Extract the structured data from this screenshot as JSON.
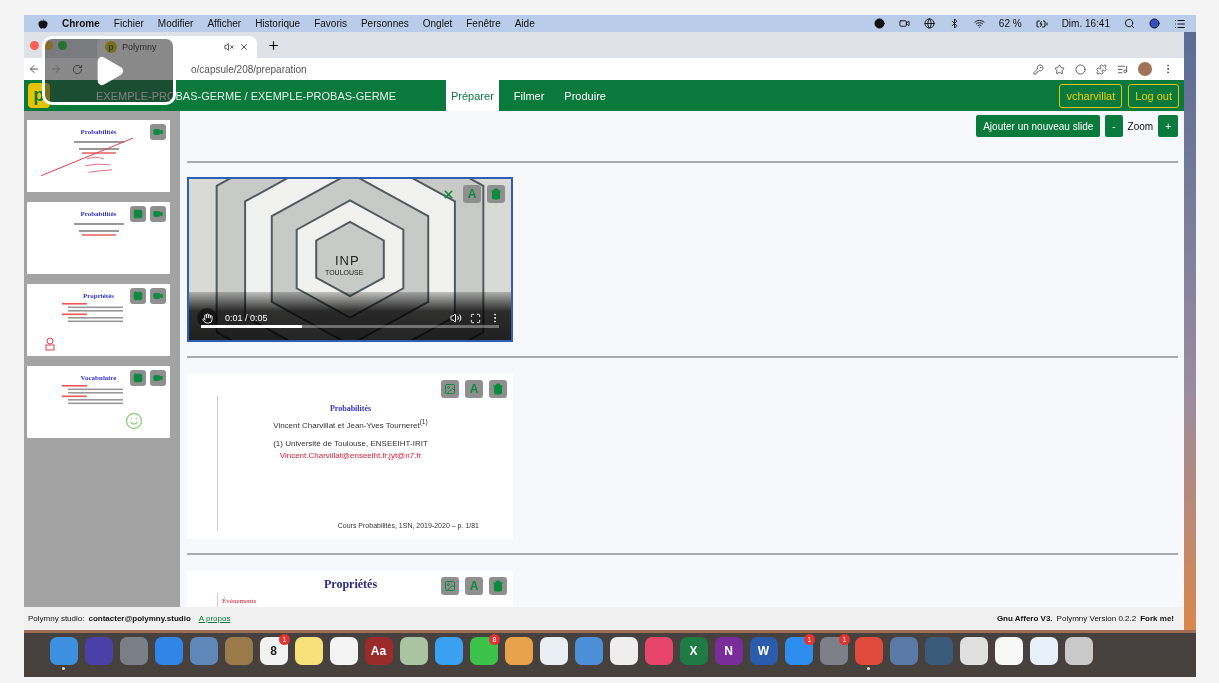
{
  "menu_bar": {
    "app": "Chrome",
    "items": [
      "Fichier",
      "Modifier",
      "Afficher",
      "Historique",
      "Favoris",
      "Personnes",
      "Onglet",
      "Fenêtre",
      "Aide"
    ],
    "battery": "62 %",
    "clock": "Dim. 16:41"
  },
  "browser": {
    "favicon": "p",
    "tab_title": "Polymny",
    "url": "o/capsule/208/preparation"
  },
  "video_overlay": {
    "playing": false
  },
  "app_header": {
    "logo": "p",
    "capsule_title": "EXEMPLE-PROBAS-GERME / EXEMPLE-PROBAS-GERME",
    "tabs": [
      {
        "label": "Préparer",
        "selected": true
      },
      {
        "label": "Filmer",
        "selected": false
      },
      {
        "label": "Produire",
        "selected": false
      }
    ],
    "user": "vcharvillat",
    "logout": "Log out"
  },
  "sidebar": {
    "slides": [
      {
        "title": "Probabilités",
        "kind": "title",
        "annotation": {
          "kind": "handwriting"
        },
        "actions": [
          {
            "kind": "video"
          }
        ]
      },
      {
        "title": "Probabilités",
        "kind": "title",
        "actions": [
          {
            "kind": "film"
          },
          {
            "kind": "video"
          }
        ]
      },
      {
        "title": "Propriétés",
        "kind": "list",
        "annotation": {
          "kind": "figure"
        },
        "actions": [
          {
            "kind": "film"
          },
          {
            "kind": "video"
          }
        ]
      },
      {
        "title": "Vocabulaire",
        "kind": "list",
        "annotation": {
          "kind": "smiley"
        },
        "actions": [
          {
            "kind": "film"
          },
          {
            "kind": "video"
          }
        ]
      }
    ]
  },
  "toolbar": {
    "add": "Ajouter un nouveau slide",
    "zoom_out": "-",
    "zoom_label": "Zoom",
    "zoom_in": "+"
  },
  "items": [
    {
      "kind": "video",
      "logo": "INP",
      "logo_sub": "TOULOUSE",
      "time": "0:01 / 0:05",
      "level": 0.34,
      "actions": [
        {
          "kind": "close"
        },
        {
          "kind": "text",
          "label": "A"
        },
        {
          "kind": "delete"
        }
      ]
    },
    {
      "kind": "title_slide",
      "title": "Probabilités",
      "authors": "Vincent Charvillat et Jean-Yves Tourneret$^{(1)}$",
      "affiliation": "(1) Université de Toulouse, ENSEEIHT-IRIT",
      "email": "Vincent.Charvillat@enseeiht.fr,jyt@n7.fr",
      "footer": "Cours Probabilités, 1SN, 2019-2020 – p. 1/81",
      "actions": [
        {
          "kind": "image"
        },
        {
          "kind": "text",
          "label": "A"
        },
        {
          "kind": "delete"
        }
      ]
    },
    {
      "kind": "list_slide",
      "title": "Propriétés",
      "bullets": [
        "Événements"
      ],
      "actions": [
        {
          "kind": "image"
        },
        {
          "kind": "text",
          "label": "A"
        },
        {
          "kind": "delete"
        }
      ]
    }
  ],
  "status_bar": {
    "site": "Polymny studio:",
    "contact": "contacter@polymny.studio",
    "about": "A propos",
    "license": "Gnu Affero V3.",
    "version": "Polymny Version 0.2.2",
    "fork": "Fork me!"
  },
  "dock": [
    {
      "color": "#3d8fe0",
      "running": true
    },
    {
      "color": "#4b3fa8",
      "running": false
    },
    {
      "color": "#7a7f87",
      "running": false
    },
    {
      "color": "#2f86e8",
      "running": false
    },
    {
      "color": "#5f87b8",
      "running": false
    },
    {
      "color": "#9b7a4a",
      "running": false
    },
    {
      "color": "#f2f2f2",
      "glyph": "8",
      "badge": "1",
      "running": false
    },
    {
      "color": "#f7e27a",
      "running": false
    },
    {
      "color": "#f4f4f4",
      "running": false
    },
    {
      "color": "#9b2b2b",
      "glyph": "Aa",
      "running": false
    },
    {
      "color": "#a8c4a0",
      "running": false
    },
    {
      "color": "#3aa0f0",
      "running": false
    },
    {
      "color": "#3cc24a",
      "badge": "8",
      "running": false
    },
    {
      "color": "#e8a24a",
      "running": false
    },
    {
      "color": "#e9eef4",
      "running": false
    },
    {
      "color": "#4b8fd9",
      "running": false
    },
    {
      "color": "#eeeeee",
      "running": false
    },
    {
      "color": "#e8456a",
      "running": false
    },
    {
      "color": "#1f7a43",
      "glyph": "X",
      "running": false
    },
    {
      "color": "#7a2d9a",
      "glyph": "N",
      "running": false
    },
    {
      "color": "#2b5cab",
      "glyph": "W",
      "running": false
    },
    {
      "color": "#2e8ef0",
      "badge": "1",
      "running": false
    },
    {
      "color": "#7d8088",
      "badge": "1",
      "running": false
    },
    {
      "color": "#e04a3a",
      "running": true
    },
    {
      "color": "#5a7aa8",
      "running": false
    },
    {
      "color": "#3a5a7a",
      "running": false
    },
    {
      "color": "#e0e0e0",
      "running": false
    },
    {
      "color": "#f8f8f8",
      "running": false
    },
    {
      "color": "#e8f0fa",
      "running": false
    },
    {
      "color": "#c9c9c9",
      "running": false
    }
  ]
}
